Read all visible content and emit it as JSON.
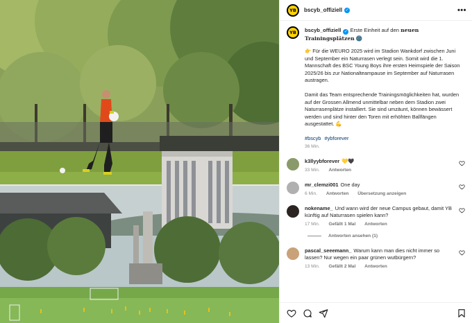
{
  "post": {
    "author": "bscyb_offiziell",
    "avatar_text": "YB",
    "caption_intro": "Erste Einheit auf den",
    "caption_bold": "neuen Trainingsplätzen",
    "caption_emoji": "🌚",
    "paragraph1": "👉 Für die WEURO 2025 wird im Stadion Wankdorf zwischen Juni und September ein Naturrasen verlegt sein. Somit wird die 1. Mannschaft des BSC Young Boys ihre ersten Heimspiele der Saison 2025/26 bis zur Nationalteampause im September auf Naturrasen austragen.",
    "paragraph2": "Damit das Team entsprechende Trainingsmöglichkeiten hat, wurden auf der Grossen Allmend unmittelbar neben dem Stadion zwei Naturrasenplätze installiert. Sie sind umzäunt, können bewässert werden und sind hinter den Toren mit erhöhten Ballfängen ausgestattet. 💪",
    "hashtags": [
      "#bscyb",
      "#ybforever"
    ],
    "time": "36 Min."
  },
  "comments": [
    {
      "user": "k3llyybforever",
      "text": "💛🖤",
      "time": "33 Min.",
      "actions": [
        "Antworten"
      ],
      "avatar_color": "#8a9a6a"
    },
    {
      "user": "mr_clemzi001",
      "text": "One day",
      "time": "6 Min.",
      "actions": [
        "Antworten",
        "Übersetzung anzeigen"
      ],
      "avatar_color": "#b0b0b0"
    },
    {
      "user": "nokename_",
      "text": "Und wann wird der neue Campus gebaut, damit YB künftig auf Naturrasen spielen kann?",
      "time": "17 Min.",
      "actions": [
        "Gefällt 1 Mal",
        "Antworten"
      ],
      "avatar_color": "#2b2420"
    },
    {
      "user": "pascal_seeemann_",
      "text": "Warum kann man dies nicht immer so lassen? Nur wegen ein paar grünen wutbürgern?",
      "time": "13 Min.",
      "actions": [
        "Gefällt 2 Mal",
        "Antworten"
      ],
      "avatar_color": "#c9a27a"
    }
  ],
  "replies_label": "Antworten ansehen (1)",
  "icons": [
    "more-icon",
    "heart-icon",
    "comment-icon",
    "share-icon",
    "save-icon",
    "verified-icon"
  ],
  "colors": {
    "brand_yellow": "#ffd300",
    "verified_blue": "#0095f6",
    "hashtag": "#00376b",
    "meta_gray": "#8e8e8e"
  }
}
